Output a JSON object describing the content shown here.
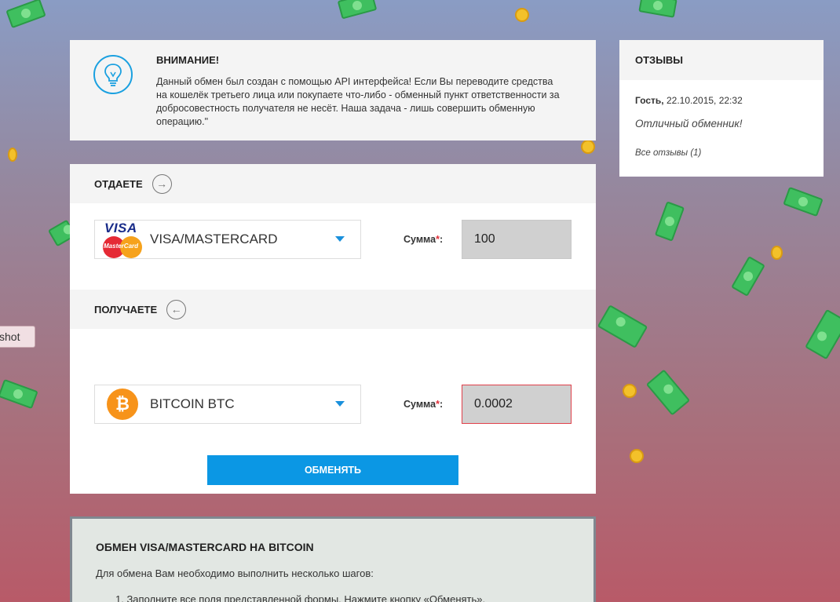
{
  "notice": {
    "title": "ВНИМАНИЕ!",
    "text": "Данный обмен был создан с помощью API интерфейса! Если Вы переводите средства на кошелёк третьего лица или покупаете что-либо - обменный пункт ответственности за добросовестность получателя не несёт. Наша задача - лишь совершить обменную операцию.\""
  },
  "reviews": {
    "title": "ОТЗЫВЫ",
    "author": "Гость,",
    "date": "22.10.2015, 22:32",
    "text": "Отличный обменник!",
    "all_link": "Все отзывы (1)"
  },
  "exchange": {
    "give_label": "ОТДАЕТЕ",
    "receive_label": "ПОЛУЧАЕТЕ",
    "give_currency": "VISA/MASTERCARD",
    "receive_currency": "BITCOIN BTC",
    "sum_label": "Сумма",
    "required_mark": "*",
    "sum_colon": ":",
    "give_amount": "100",
    "receive_amount": "0.0002",
    "submit_label": "ОБМЕНЯТЬ",
    "visa_text": "VISA",
    "mastercard_text": "MasterCard"
  },
  "info": {
    "title": "ОБМЕН VISA/MASTERCARD НА BITCOIN",
    "intro": "Для обмена Вам необходимо выполнить несколько шагов:",
    "step1": "1. Заполните все поля представленной формы. Нажмите кнопку «Обменять»."
  },
  "screenshot_tab": "shot"
}
